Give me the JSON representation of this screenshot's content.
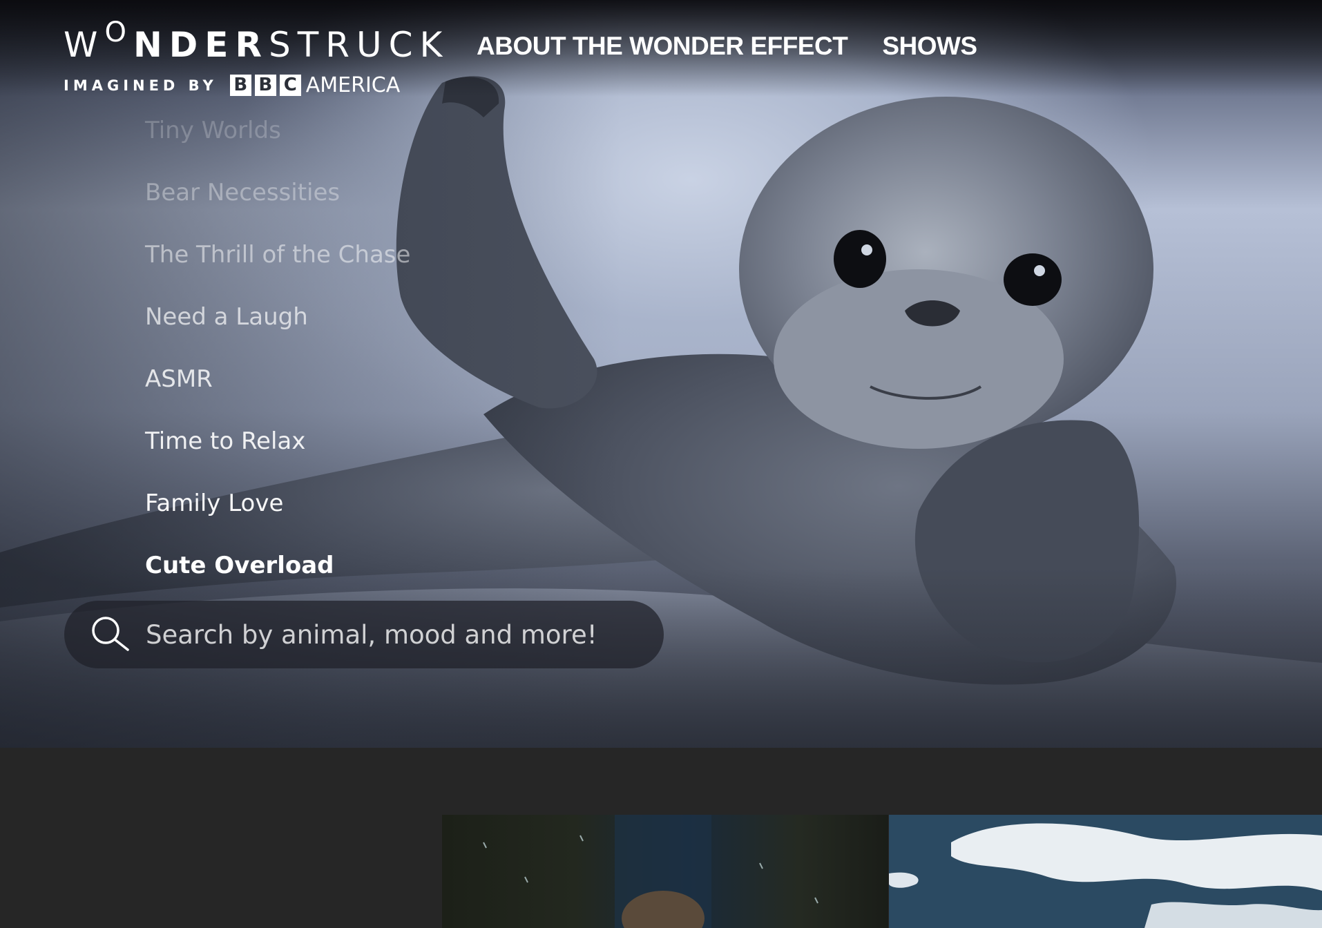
{
  "brand": {
    "name_pre": "W",
    "name_o": "O",
    "name_bold": "NDER",
    "name_light": "STRUCK",
    "imagined_by": "IMAGINED BY",
    "bbc_letters": [
      "B",
      "B",
      "C"
    ],
    "america": "AMERICA"
  },
  "nav": {
    "items": [
      {
        "label": "ABOUT THE WONDER EFFECT"
      },
      {
        "label": "SHOWS"
      }
    ]
  },
  "moods": {
    "items": [
      {
        "label": "Tiny Worlds",
        "opacity": 0.22
      },
      {
        "label": "Bear Necessities",
        "opacity": 0.35
      },
      {
        "label": "The Thrill of the Chase",
        "opacity": 0.5
      },
      {
        "label": "Need a Laugh",
        "opacity": 0.68
      },
      {
        "label": "ASMR",
        "opacity": 0.82
      },
      {
        "label": "Time to Relax",
        "opacity": 0.9
      },
      {
        "label": "Family Love",
        "opacity": 0.96
      },
      {
        "label": "Cute Overload",
        "opacity": 1.0
      }
    ],
    "active": "Cute Overload"
  },
  "search": {
    "placeholder": "Search by animal, mood and more!",
    "value": ""
  },
  "colors": {
    "page_bg": "#262626",
    "text": "#ffffff"
  }
}
